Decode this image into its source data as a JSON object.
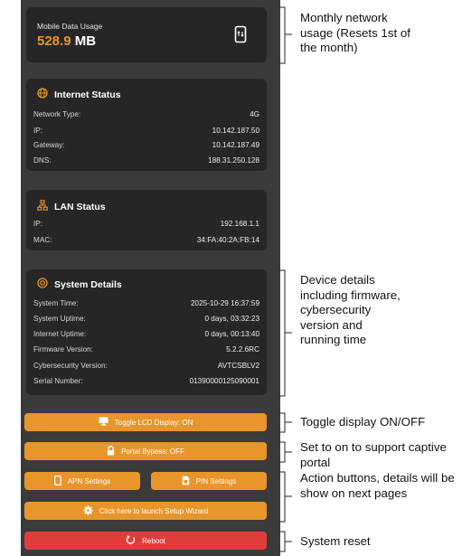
{
  "mobile_usage": {
    "label": "Mobile Data Usage",
    "value": "528.9",
    "unit": "MB",
    "icon": "phone-data-icon"
  },
  "internet_status": {
    "title": "Internet Status",
    "icon": "globe-icon",
    "rows": [
      {
        "label": "Network Type:",
        "value": "4G"
      },
      {
        "label": "IP:",
        "value": "10.142.187.50"
      },
      {
        "label": "Gateway:",
        "value": "10.142.187.49"
      },
      {
        "label": "DNS:",
        "value": "188.31.250.128"
      }
    ]
  },
  "lan_status": {
    "title": "LAN Status",
    "icon": "network-icon",
    "rows": [
      {
        "label": "IP:",
        "value": "192.168.1.1"
      },
      {
        "label": "MAC:",
        "value": "34:FA:40:2A:FB:14"
      }
    ]
  },
  "system_details": {
    "title": "System Details",
    "icon": "target-icon",
    "rows": [
      {
        "label": "System Time:",
        "value": "2025-10-29 16:37:59"
      },
      {
        "label": "System Uptime:",
        "value": "0 days, 03:32:23"
      },
      {
        "label": "Internet Uptime:",
        "value": "0 days, 00:13:40"
      },
      {
        "label": "Firmware Version:",
        "value": "5.2.2.6RC"
      },
      {
        "label": "Cybersecurity Version:",
        "value": "AVTCSBLV2"
      },
      {
        "label": "Serial Number:",
        "value": "01390000125090001"
      }
    ]
  },
  "buttons": {
    "toggle_lcd": "Toggle LCD Display: ON",
    "portal_bypass": "Portal Bypass: OFF",
    "apn_settings": "APN Settings",
    "pin_settings": "PIN Settings",
    "setup_wizard": "Click here to launch Setup Wizard",
    "reboot": "Reboot"
  },
  "annotations": {
    "monthly_usage": "Monthly network usage (Resets 1st of the month)",
    "device_details": "Device details including firmware, cybersecurity version and running time",
    "toggle_display": "Toggle display ON/OFF",
    "captive_portal": "Set to on to support captive portal",
    "action_buttons": "Action buttons, details will be show on next pages",
    "system_reset": "System reset"
  },
  "colors": {
    "accent": "#e8962b",
    "danger": "#e23b3b",
    "card": "#262626",
    "background": "#3a3a3a"
  }
}
